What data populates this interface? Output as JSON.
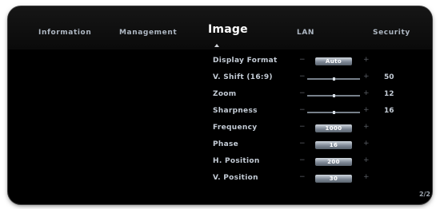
{
  "tabs": [
    {
      "label": "Information",
      "active": false
    },
    {
      "label": "Management",
      "active": false
    },
    {
      "label": "Image",
      "active": true
    },
    {
      "label": "LAN",
      "active": false
    },
    {
      "label": "Security",
      "active": false
    }
  ],
  "settings": [
    {
      "label": "Display Format",
      "control": "select",
      "value": "Auto"
    },
    {
      "label": "V. Shift (16:9)",
      "control": "slider",
      "value": "50",
      "level": 0.5
    },
    {
      "label": "Zoom",
      "control": "slider",
      "value": "12",
      "level": 0.5
    },
    {
      "label": "Sharpness",
      "control": "slider",
      "value": "16",
      "level": 0.5
    },
    {
      "label": "Frequency",
      "control": "value",
      "value": "1000"
    },
    {
      "label": "Phase",
      "control": "value",
      "value": "16"
    },
    {
      "label": "H. Position",
      "control": "value",
      "value": "200"
    },
    {
      "label": "V. Position",
      "control": "value",
      "value": "30"
    }
  ],
  "controls": {
    "minus": "−",
    "plus": "+"
  },
  "page": "2/2"
}
